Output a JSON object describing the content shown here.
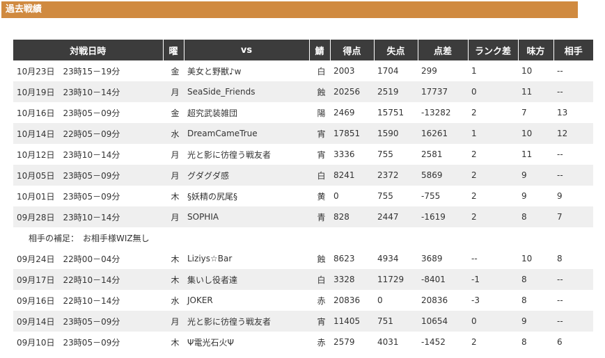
{
  "section": {
    "title": "過去戦績"
  },
  "colors": {
    "header_bar": "#d08a40",
    "table_header": "#3c3c3c",
    "row_alt": "#efefef"
  },
  "columns": [
    "対戦日時",
    "曜",
    "vs",
    "鯖",
    "得点",
    "失点",
    "点差",
    "ランク差",
    "味方",
    "相手"
  ],
  "rows": [
    {
      "date": "10月23日　23時15－19分",
      "day": "金",
      "vs": "美女と野獣♪w",
      "color": "白",
      "score": "2003",
      "lost": "1704",
      "diff": "299",
      "rank_diff": "1",
      "ally": "10",
      "opp": "--"
    },
    {
      "date": "10月19日　23時10－14分",
      "day": "月",
      "vs": "SeaSide_Friends",
      "color": "蝕",
      "score": "20256",
      "lost": "2519",
      "diff": "17737",
      "rank_diff": "0",
      "ally": "11",
      "opp": "--"
    },
    {
      "date": "10月16日　23時05－09分",
      "day": "金",
      "vs": "超究武装雑団",
      "color": "陽",
      "score": "2469",
      "lost": "15751",
      "diff": "-13282",
      "rank_diff": "2",
      "ally": "7",
      "opp": "13"
    },
    {
      "date": "10月14日　22時05－09分",
      "day": "水",
      "vs": "DreamCameTrue",
      "color": "宵",
      "score": "17851",
      "lost": "1590",
      "diff": "16261",
      "rank_diff": "1",
      "ally": "10",
      "opp": "12"
    },
    {
      "date": "10月12日　23時10－14分",
      "day": "月",
      "vs": "光と影に彷徨う戦友者",
      "color": "宵",
      "score": "3336",
      "lost": "755",
      "diff": "2581",
      "rank_diff": "2",
      "ally": "11",
      "opp": "--"
    },
    {
      "date": "10月05日　23時05－09分",
      "day": "月",
      "vs": "グダグダ感",
      "color": "白",
      "score": "8241",
      "lost": "2372",
      "diff": "5869",
      "rank_diff": "2",
      "ally": "9",
      "opp": "--"
    },
    {
      "date": "10月01日　23時05－09分",
      "day": "木",
      "vs": "§妖精の尻尾§",
      "color": "黄",
      "score": "0",
      "lost": "755",
      "diff": "-755",
      "rank_diff": "2",
      "ally": "9",
      "opp": "9"
    },
    {
      "date": "09月28日　23時10－14分",
      "day": "月",
      "vs": "SOPHIA",
      "color": "青",
      "score": "828",
      "lost": "2447",
      "diff": "-1619",
      "rank_diff": "2",
      "ally": "8",
      "opp": "7"
    },
    {
      "note": "相手の補足：　お相手様WIZ無し"
    },
    {
      "date": "09月24日　22時00－04分",
      "day": "木",
      "vs": "Liziys☆Bar",
      "color": "蝕",
      "score": "8623",
      "lost": "4934",
      "diff": "3689",
      "rank_diff": "--",
      "ally": "10",
      "opp": "8"
    },
    {
      "date": "09月17日　22時10－14分",
      "day": "木",
      "vs": "集いし役者達",
      "color": "白",
      "score": "3328",
      "lost": "11729",
      "diff": "-8401",
      "rank_diff": "-1",
      "ally": "8",
      "opp": "--"
    },
    {
      "date": "09月16日　22時10－14分",
      "day": "水",
      "vs": "JOKER",
      "color": "赤",
      "score": "20836",
      "lost": "0",
      "diff": "20836",
      "rank_diff": "-3",
      "ally": "8",
      "opp": "--"
    },
    {
      "date": "09月14日　23時05－09分",
      "day": "月",
      "vs": "光と影に彷徨う戦友者",
      "color": "宵",
      "score": "11405",
      "lost": "751",
      "diff": "10654",
      "rank_diff": "0",
      "ally": "9",
      "opp": "--"
    },
    {
      "date": "09月10日　23時05－09分",
      "day": "木",
      "vs": "Ψ電光石火Ψ",
      "color": "赤",
      "score": "2579",
      "lost": "4031",
      "diff": "-1452",
      "rank_diff": "2",
      "ally": "8",
      "opp": "6"
    }
  ]
}
